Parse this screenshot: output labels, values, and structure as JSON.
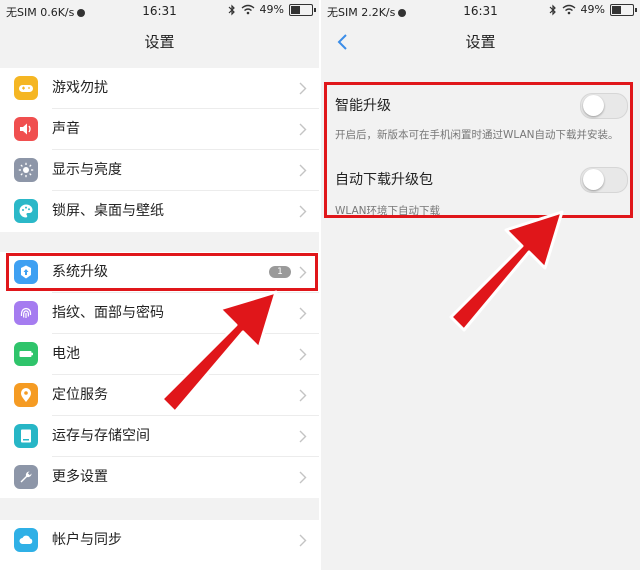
{
  "left_screen": {
    "status": {
      "carrier": "无SIM 0.6K/s",
      "time": "16:31",
      "battery": "49%",
      "battery_level": 0.49
    },
    "title": "设置",
    "groups": [
      [
        {
          "label": "游戏勿扰",
          "icon": "gamepad-icon",
          "color": "#f5b623"
        },
        {
          "label": "声音",
          "icon": "speaker-icon",
          "color": "#f04f4f"
        },
        {
          "label": "显示与亮度",
          "icon": "brightness-icon",
          "color": "#8d96a8"
        },
        {
          "label": "锁屏、桌面与壁纸",
          "icon": "palette-icon",
          "color": "#2bb8c8"
        }
      ],
      [
        {
          "label": "系统升级",
          "icon": "upgrade-icon",
          "color": "#3ea0f2",
          "badge": "1"
        },
        {
          "label": "指纹、面部与密码",
          "icon": "fingerprint-icon",
          "color": "#a57cf0"
        },
        {
          "label": "电池",
          "icon": "battery-icon",
          "color": "#2fc46b"
        },
        {
          "label": "定位服务",
          "icon": "location-icon",
          "color": "#f59b23"
        },
        {
          "label": "运存与存储空间",
          "icon": "storage-icon",
          "color": "#27b6c6"
        },
        {
          "label": "更多设置",
          "icon": "wrench-icon",
          "color": "#8d96a8"
        }
      ],
      [
        {
          "label": "帐户与同步",
          "icon": "cloud-icon",
          "color": "#2fb0e6"
        }
      ]
    ]
  },
  "right_screen": {
    "status": {
      "carrier": "无SIM 2.2K/s",
      "time": "16:31",
      "battery": "49%",
      "battery_level": 0.49
    },
    "title": "设置",
    "smart_upgrade": {
      "label": "智能升级",
      "enabled": false,
      "description": "开启后，新版本可在手机闲置时通过WLAN自动下载并安装。"
    },
    "auto_download": {
      "label": "自动下载升级包",
      "enabled": false,
      "description": "WLAN环境下自动下载"
    }
  },
  "annotation_color": "#e0161a"
}
